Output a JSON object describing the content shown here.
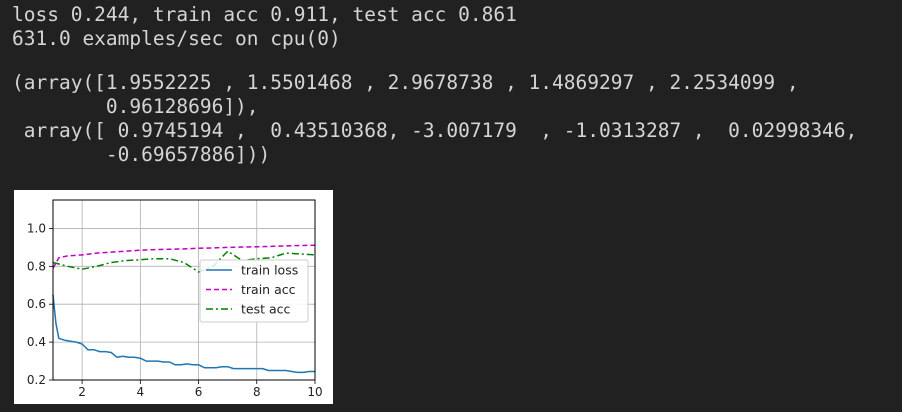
{
  "output": {
    "status_line_1": "loss 0.244, train acc 0.911, test acc 0.861",
    "status_line_2": "631.0 examples/sec on cpu(0)",
    "array_line_1": "(array([1.9552225 , 1.5501468 , 2.9678738 , 1.4869297 , 2.2534099 ,",
    "array_line_2": "        0.96128696]),",
    "array_line_3": " array([ 0.9745194 ,  0.43510368, -3.007179  , -1.0313287 ,  0.02998346,",
    "array_line_4": "        -0.69657886]))"
  },
  "colors": {
    "background": "#212121",
    "text": "#d4d4d4",
    "train_loss": "#1f77b4",
    "train_acc": "#bf00bf",
    "test_acc": "#008000"
  },
  "chart_data": {
    "type": "line",
    "title": "",
    "xlabel": "",
    "ylabel": "",
    "xlim": [
      1,
      10
    ],
    "ylim": [
      0.2,
      1.15
    ],
    "grid": true,
    "legend_position": "center-right",
    "x_ticks": [
      "2",
      "4",
      "6",
      "8",
      "10"
    ],
    "y_ticks": [
      "0.2",
      "0.4",
      "0.6",
      "0.8",
      "1.0"
    ],
    "series": [
      {
        "name": "train loss",
        "style": "solid",
        "color": "#1f77b4",
        "x": [
          1.0,
          1.1,
          1.2,
          1.4,
          1.6,
          1.8,
          2.0,
          2.2,
          2.4,
          2.6,
          2.8,
          3.0,
          3.2,
          3.4,
          3.6,
          3.8,
          4.0,
          4.2,
          4.4,
          4.6,
          4.8,
          5.0,
          5.2,
          5.4,
          5.6,
          5.8,
          6.0,
          6.2,
          6.4,
          6.6,
          6.8,
          7.0,
          7.2,
          7.4,
          7.6,
          7.8,
          8.0,
          8.2,
          8.4,
          8.6,
          8.8,
          9.0,
          9.2,
          9.4,
          9.6,
          9.8,
          10.0
        ],
        "y": [
          0.65,
          0.5,
          0.42,
          0.41,
          0.405,
          0.4,
          0.39,
          0.36,
          0.36,
          0.35,
          0.35,
          0.345,
          0.32,
          0.325,
          0.32,
          0.32,
          0.315,
          0.3,
          0.3,
          0.3,
          0.295,
          0.295,
          0.28,
          0.28,
          0.285,
          0.28,
          0.28,
          0.265,
          0.265,
          0.265,
          0.27,
          0.27,
          0.26,
          0.26,
          0.26,
          0.26,
          0.26,
          0.26,
          0.25,
          0.25,
          0.25,
          0.25,
          0.245,
          0.24,
          0.24,
          0.245,
          0.245
        ]
      },
      {
        "name": "train acc",
        "style": "dashed",
        "color": "#bf00bf",
        "x": [
          1.0,
          1.2,
          1.5,
          2.0,
          2.5,
          3.0,
          3.5,
          4.0,
          4.5,
          5.0,
          5.5,
          6.0,
          6.5,
          7.0,
          7.5,
          8.0,
          8.5,
          9.0,
          9.5,
          10.0
        ],
        "y": [
          0.79,
          0.845,
          0.855,
          0.86,
          0.87,
          0.875,
          0.88,
          0.885,
          0.888,
          0.89,
          0.892,
          0.895,
          0.897,
          0.9,
          0.902,
          0.903,
          0.905,
          0.908,
          0.91,
          0.911
        ]
      },
      {
        "name": "test acc",
        "style": "dashdot",
        "color": "#008000",
        "x": [
          1.0,
          1.5,
          2.0,
          2.5,
          3.0,
          3.5,
          4.0,
          4.5,
          5.0,
          5.5,
          6.0,
          6.5,
          7.0,
          7.5,
          8.0,
          8.5,
          9.0,
          9.5,
          10.0
        ],
        "y": [
          0.82,
          0.8,
          0.785,
          0.8,
          0.82,
          0.83,
          0.835,
          0.84,
          0.84,
          0.82,
          0.77,
          0.8,
          0.88,
          0.83,
          0.84,
          0.845,
          0.87,
          0.865,
          0.861
        ]
      }
    ]
  }
}
